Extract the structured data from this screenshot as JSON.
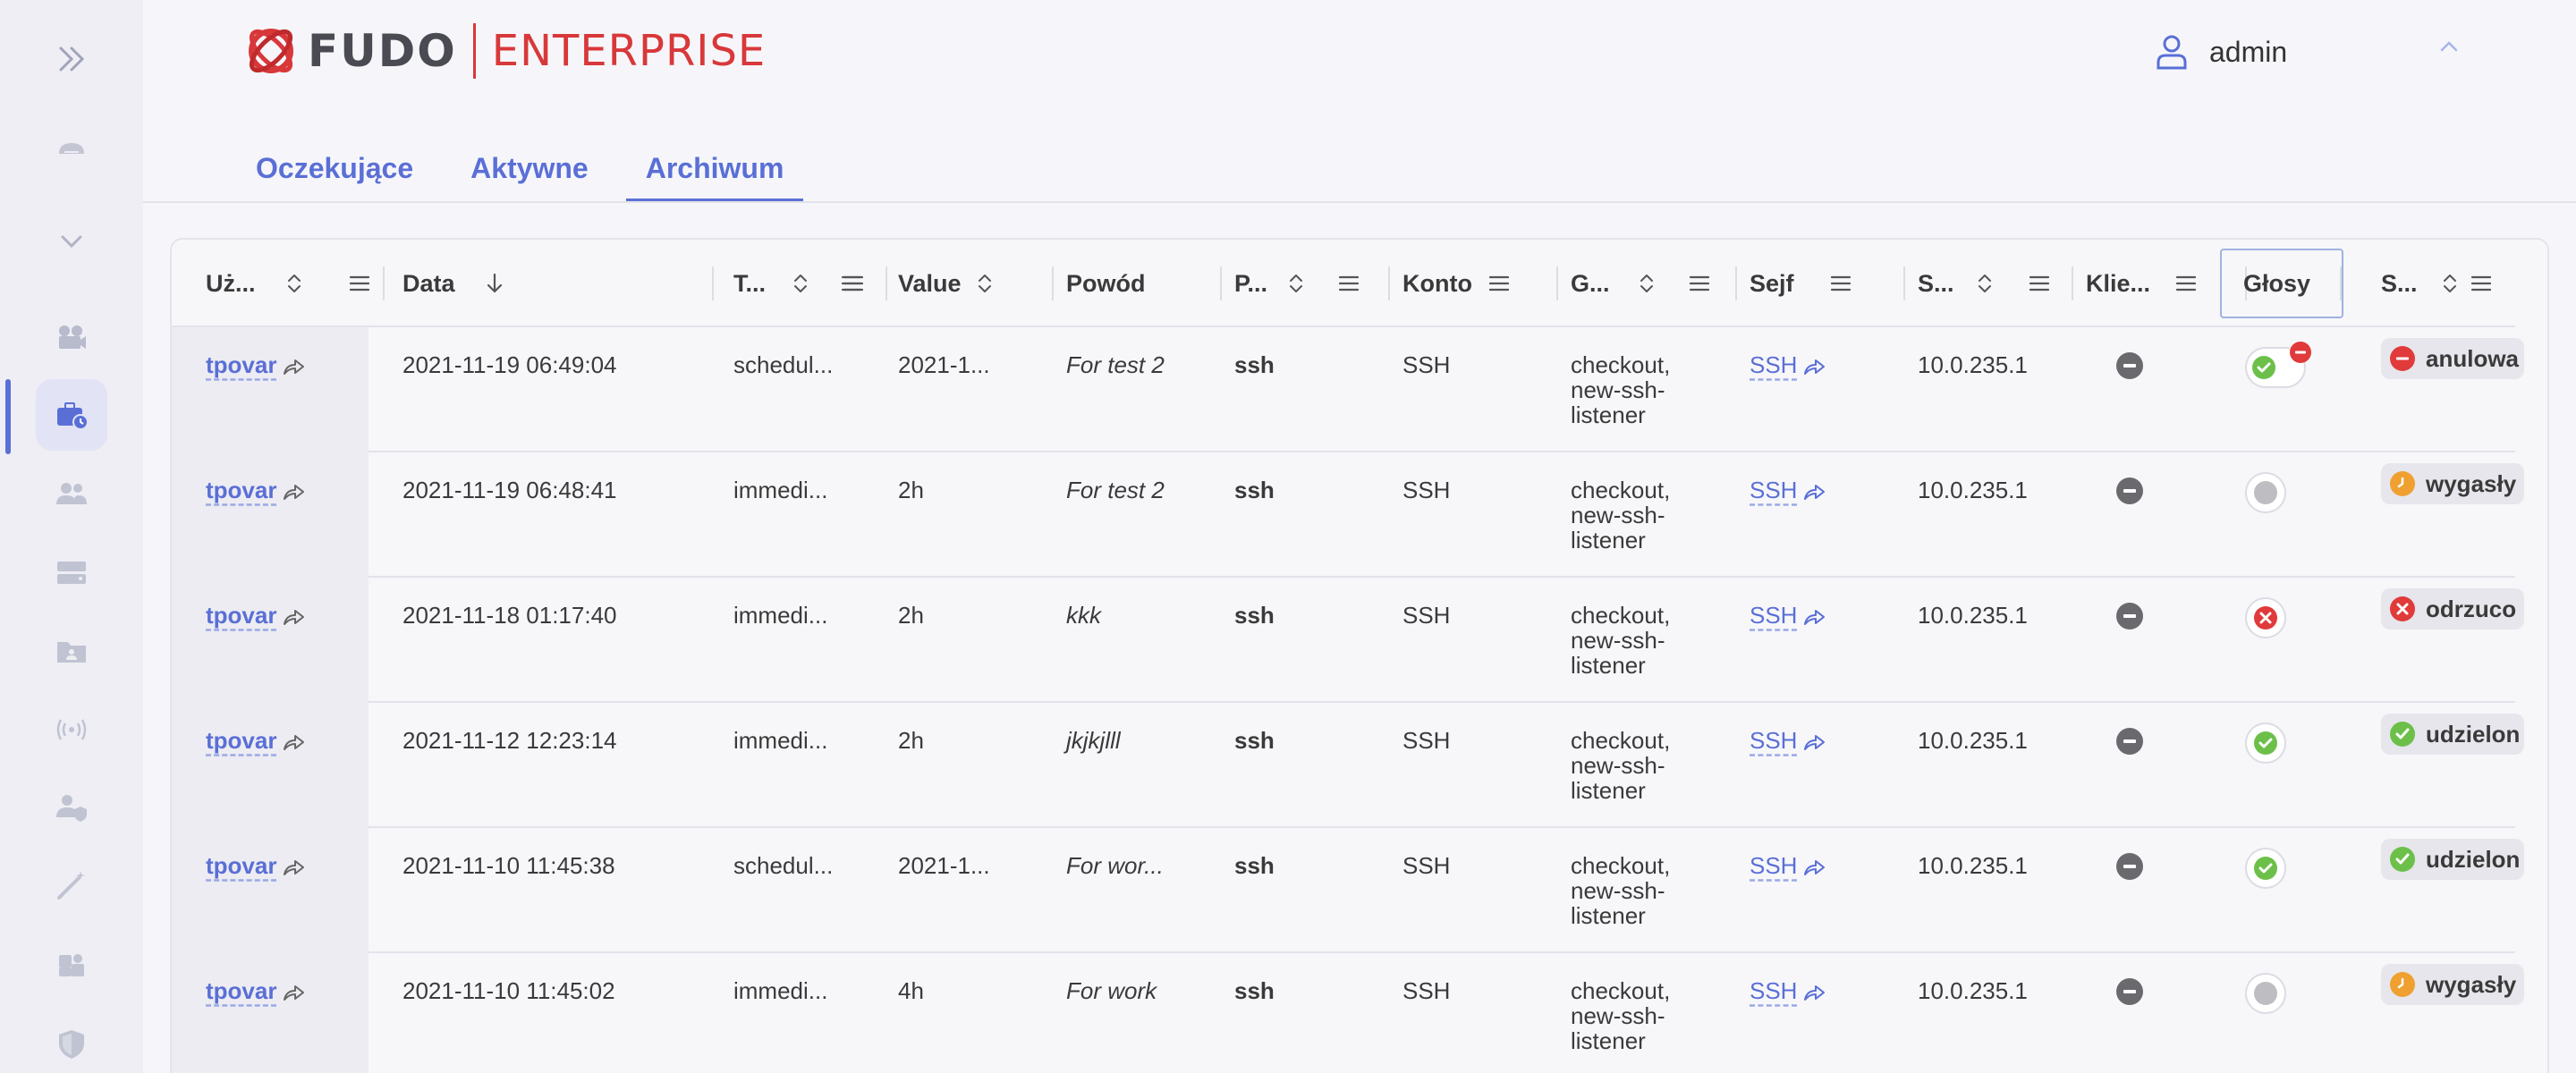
{
  "header": {
    "logo_brand": "FUDO",
    "logo_product": "ENTERPRISE",
    "user_name": "admin"
  },
  "sidebar": {
    "items": [
      {
        "icon": "double-chevron-right-icon"
      },
      {
        "icon": "cloud-icon"
      },
      {
        "icon": "chevron-down-icon"
      },
      {
        "icon": "video-camera-icon"
      },
      {
        "icon": "briefcase-clock-icon",
        "active": true
      },
      {
        "icon": "users-icon"
      },
      {
        "icon": "server-icon"
      },
      {
        "icon": "folder-user-icon"
      },
      {
        "icon": "broadcast-icon"
      },
      {
        "icon": "user-shield-icon"
      },
      {
        "icon": "magic-wand-icon"
      },
      {
        "icon": "puzzle-icon"
      },
      {
        "icon": "shield-icon"
      }
    ]
  },
  "tabs": [
    {
      "label": "Oczekujące",
      "active": false
    },
    {
      "label": "Aktywne",
      "active": false
    },
    {
      "label": "Archiwum",
      "active": true
    }
  ],
  "table": {
    "columns": [
      "Uż...",
      "Data",
      "T...",
      "Value",
      "Powód",
      "P...",
      "Konto",
      "G...",
      "Sejf",
      "S...",
      "Klie...",
      "Głosy",
      "S..."
    ],
    "rows": [
      {
        "user": "tpovar",
        "date": "2021-11-19 06:49:04",
        "type": "schedul...",
        "value": "2021-1...",
        "reason": "For test 2",
        "protocol": "ssh",
        "account": "SSH",
        "groups": [
          "checkout,",
          "new-ssh-",
          "listener"
        ],
        "safe": "SSH",
        "server": "10.0.235.1",
        "vote": "approved-revoked",
        "status": "anulowa",
        "status_kind": "cancelled"
      },
      {
        "user": "tpovar",
        "date": "2021-11-19 06:48:41",
        "type": "immedi...",
        "value": "2h",
        "reason": "For test 2",
        "protocol": "ssh",
        "account": "SSH",
        "groups": [
          "checkout,",
          "new-ssh-",
          "listener"
        ],
        "safe": "SSH",
        "server": "10.0.235.1",
        "vote": "none",
        "status": "wygasły",
        "status_kind": "expired"
      },
      {
        "user": "tpovar",
        "date": "2021-11-18 01:17:40",
        "type": "immedi...",
        "value": "2h",
        "reason": "kkk",
        "protocol": "ssh",
        "account": "SSH",
        "groups": [
          "checkout,",
          "new-ssh-",
          "listener"
        ],
        "safe": "SSH",
        "server": "10.0.235.1",
        "vote": "rejected",
        "status": "odrzuco",
        "status_kind": "rejected"
      },
      {
        "user": "tpovar",
        "date": "2021-11-12 12:23:14",
        "type": "immedi...",
        "value": "2h",
        "reason": "jkjkjlll",
        "protocol": "ssh",
        "account": "SSH",
        "groups": [
          "checkout,",
          "new-ssh-",
          "listener"
        ],
        "safe": "SSH",
        "server": "10.0.235.1",
        "vote": "approved",
        "status": "udzielon",
        "status_kind": "granted"
      },
      {
        "user": "tpovar",
        "date": "2021-11-10 11:45:38",
        "type": "schedul...",
        "value": "2021-1...",
        "reason": "For wor...",
        "protocol": "ssh",
        "account": "SSH",
        "groups": [
          "checkout,",
          "new-ssh-",
          "listener"
        ],
        "safe": "SSH",
        "server": "10.0.235.1",
        "vote": "approved",
        "status": "udzielon",
        "status_kind": "granted"
      },
      {
        "user": "tpovar",
        "date": "2021-11-10 11:45:02",
        "type": "immedi...",
        "value": "4h",
        "reason": "For work",
        "protocol": "ssh",
        "account": "SSH",
        "groups": [
          "checkout,",
          "new-ssh-",
          "listener"
        ],
        "safe": "SSH",
        "server": "10.0.235.1",
        "vote": "none",
        "status": "wygasły",
        "status_kind": "expired"
      }
    ]
  },
  "colors": {
    "accent": "#5a6fd6",
    "brand_red": "#d8383a",
    "green": "#6cc04a",
    "red": "#e03a3a",
    "orange": "#f0a030",
    "gray_dot": "#6a6a6e"
  }
}
